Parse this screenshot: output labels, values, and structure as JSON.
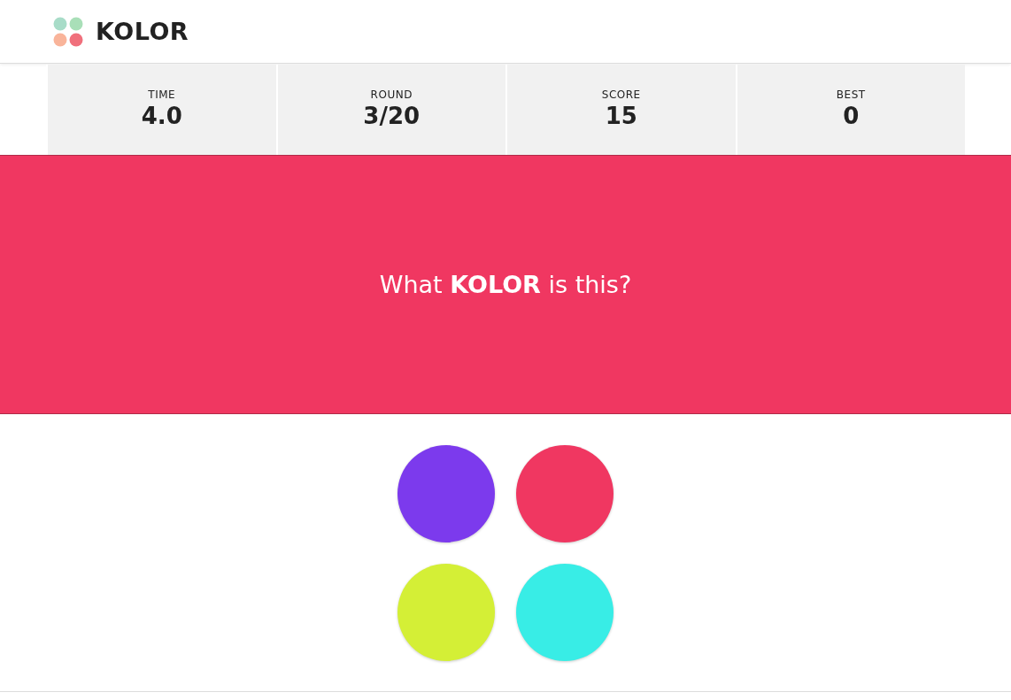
{
  "header": {
    "title": "KOLOR"
  },
  "stats": [
    {
      "label": "TIME",
      "value": "4.0"
    },
    {
      "label": "ROUND",
      "value": "3/20"
    },
    {
      "label": "SCORE",
      "value": "15"
    },
    {
      "label": "BEST",
      "value": "0"
    }
  ],
  "prompt": {
    "text": "What **KOLOR** is this?",
    "color": "#f03761"
  },
  "options": [
    {
      "color": "#7c3aed"
    },
    {
      "color": "#f03761"
    },
    {
      "color": "#d4ef36"
    },
    {
      "color": "#38ede6"
    }
  ]
}
